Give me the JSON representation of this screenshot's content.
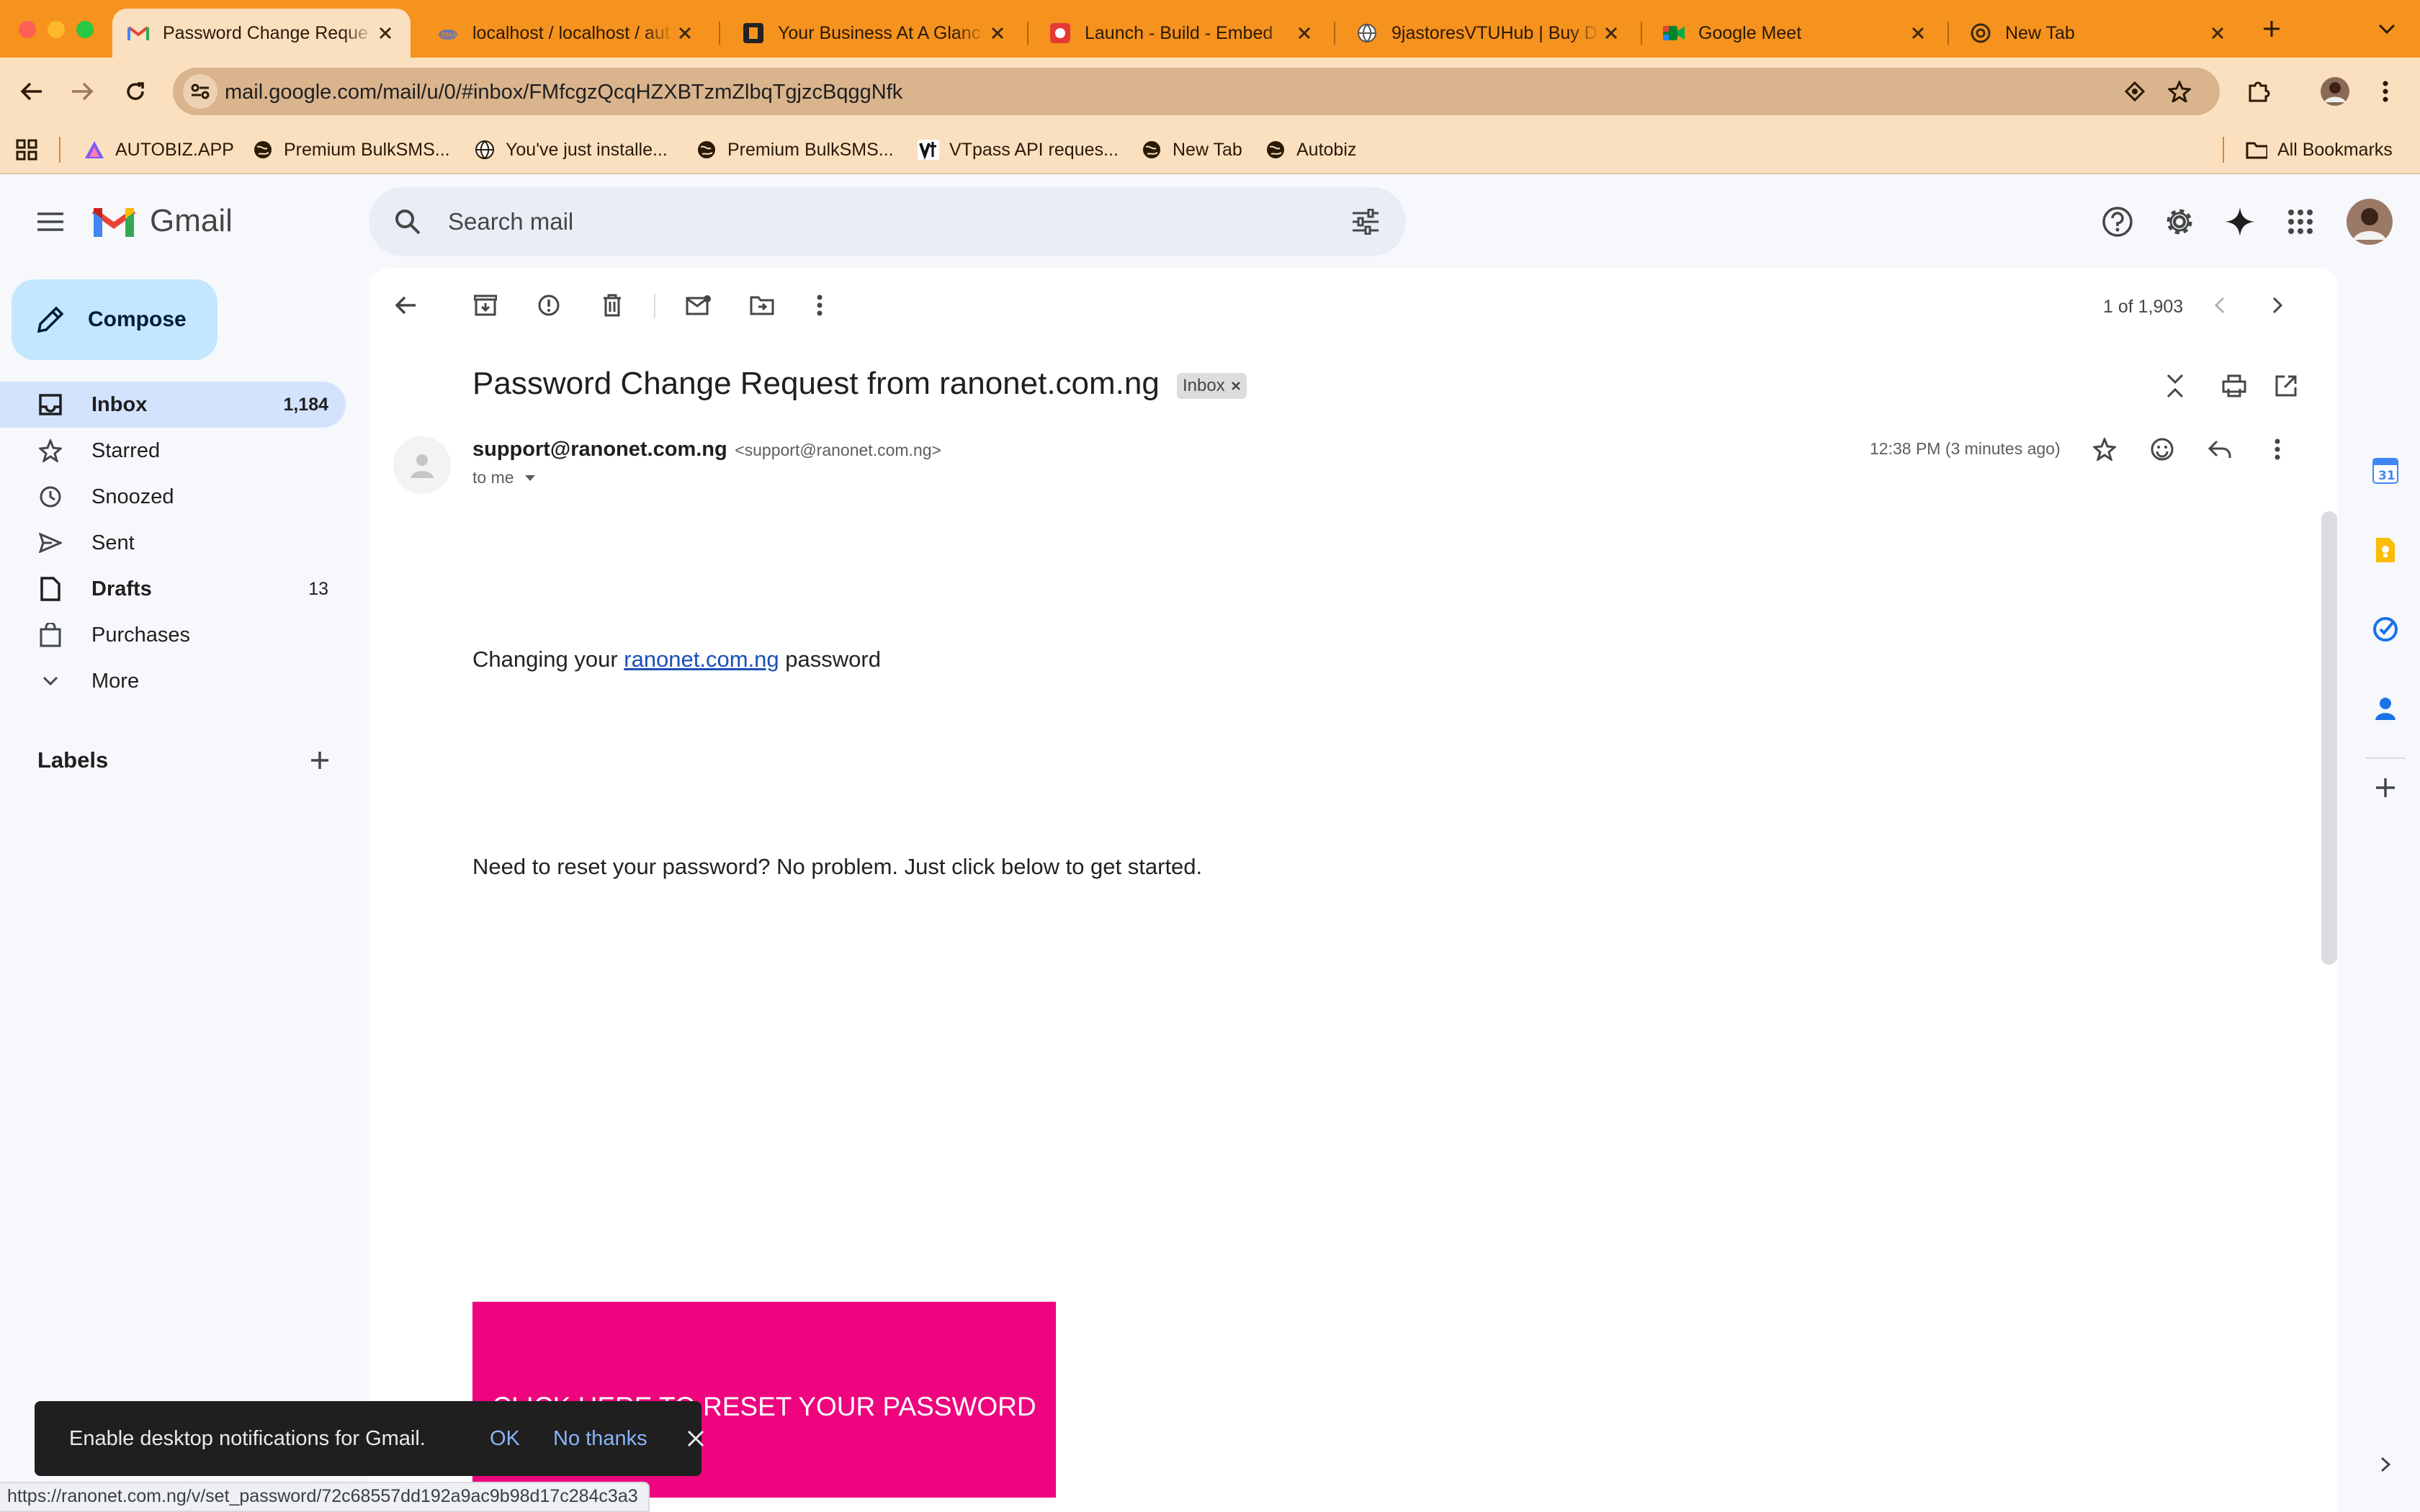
{
  "browser": {
    "tabs": [
      {
        "title": "Password Change Reque",
        "active": true,
        "icon": "gmail-icon"
      },
      {
        "title": "localhost / localhost / aut",
        "active": false,
        "icon": "phpmyadmin-icon"
      },
      {
        "title": "Your Business At A Glanc",
        "active": false,
        "icon": "business-icon"
      },
      {
        "title": "Launch - Build - Embed",
        "active": false,
        "icon": "launch-icon"
      },
      {
        "title": "9jastoresVTUHub | Buy D",
        "active": false,
        "icon": "globe-icon"
      },
      {
        "title": "Google Meet",
        "active": false,
        "icon": "google-meet-icon"
      },
      {
        "title": "New Tab",
        "active": false,
        "icon": "chrome-icon"
      }
    ],
    "url": "mail.google.com/mail/u/0/#inbox/FMfcgzQcqHZXBTzmZlbqTgjzcBqggNfk",
    "bookmarks": [
      "AUTOBIZ.APP",
      "Premium BulkSMS...",
      "You've just installe...",
      "Premium BulkSMS...",
      "VTpass API reques...",
      "New Tab",
      "Autobiz"
    ],
    "all_bookmarks": "All Bookmarks",
    "status_url": "https://ranonet.com.ng/v/set_password/72c68557dd192a9ac9b98d17c284c3a3"
  },
  "gmail": {
    "logo_text": "Gmail",
    "search_placeholder": "Search mail",
    "compose_label": "Compose",
    "nav": [
      {
        "label": "Inbox",
        "count": "1,184",
        "active": true,
        "bold": true,
        "icon": "inbox-icon"
      },
      {
        "label": "Starred",
        "count": "",
        "active": false,
        "bold": false,
        "icon": "star-icon"
      },
      {
        "label": "Snoozed",
        "count": "",
        "active": false,
        "bold": false,
        "icon": "clock-icon"
      },
      {
        "label": "Sent",
        "count": "",
        "active": false,
        "bold": false,
        "icon": "send-icon"
      },
      {
        "label": "Drafts",
        "count": "13",
        "active": false,
        "bold": true,
        "icon": "draft-icon"
      },
      {
        "label": "Purchases",
        "count": "",
        "active": false,
        "bold": false,
        "icon": "purchases-icon"
      },
      {
        "label": "More",
        "count": "",
        "active": false,
        "bold": false,
        "icon": "chevron-down-icon"
      }
    ],
    "labels_title": "Labels",
    "pagination": "1 of 1,903",
    "email": {
      "subject": "Password Change Request from ranonet.com.ng",
      "label_chip": "Inbox",
      "sender_name": "support@ranonet.com.ng",
      "sender_email": "<support@ranonet.com.ng>",
      "to": "to me",
      "time": "12:38 PM (3 minutes ago)",
      "line1_prefix": "Changing your ",
      "line1_link": "ranonet.com.ng",
      "line1_suffix": " password",
      "line2": "Need to reset your password? No problem. Just click below to get started.",
      "button_label": "CLICK HERE TO RESET YOUR PASSWORD"
    },
    "snackbar": {
      "message": "Enable desktop notifications for Gmail.",
      "ok": "OK",
      "no_thanks": "No thanks"
    }
  },
  "colors": {
    "tab_bar": "#f6921e",
    "toolbar": "#fbe0c0",
    "compose_bg": "#c2e7ff",
    "active_nav": "#d3e3fd",
    "reset_button": "#ee047f",
    "link": "#1a4fb8"
  }
}
